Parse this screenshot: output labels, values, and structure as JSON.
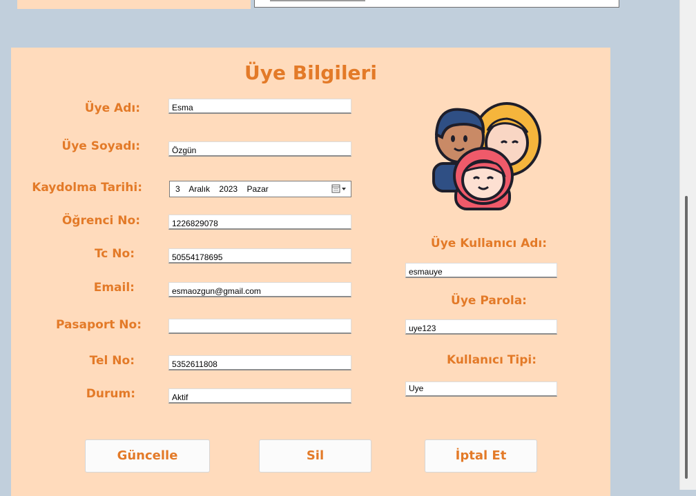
{
  "form": {
    "title": "Üye Bilgileri",
    "fields": {
      "uye_adi": {
        "label": "Üye Adı:",
        "value": "Esma"
      },
      "uye_soyadi": {
        "label": "Üye Soyadı:",
        "value": "Özgün"
      },
      "kaydolma_tarihi": {
        "label": "Kaydolma Tarihi:",
        "day": "3",
        "month": "Aralık",
        "year": "2023",
        "weekday": "Pazar"
      },
      "ogrenci_no": {
        "label": "Öğrenci No:",
        "value": "1226829078"
      },
      "tc_no": {
        "label": "Tc No:",
        "value": "50554178695"
      },
      "email": {
        "label": "Email:",
        "value": "esmaozgun@gmail.com"
      },
      "pasaport_no": {
        "label": "Pasaport No:",
        "value": ""
      },
      "tel_no": {
        "label": "Tel No:",
        "value": "5352611808"
      },
      "durum": {
        "label": "Durum:",
        "value": "Aktif"
      },
      "kullanici_adi": {
        "label": "Üye Kullanıcı Adı:",
        "value": "esmauye"
      },
      "parola": {
        "label": "Üye Parola:",
        "value": "uye123"
      },
      "kullanici_tipi": {
        "label": "Kullanıcı Tipi:",
        "value": "Uye"
      }
    },
    "buttons": {
      "guncelle": "Güncelle",
      "sil": "Sil",
      "iptal": "İptal Et"
    },
    "icon": "group-avatars-icon"
  },
  "colors": {
    "background": "#c1cfdc",
    "panel": "#ffdbbc",
    "accent": "#e37a28"
  }
}
